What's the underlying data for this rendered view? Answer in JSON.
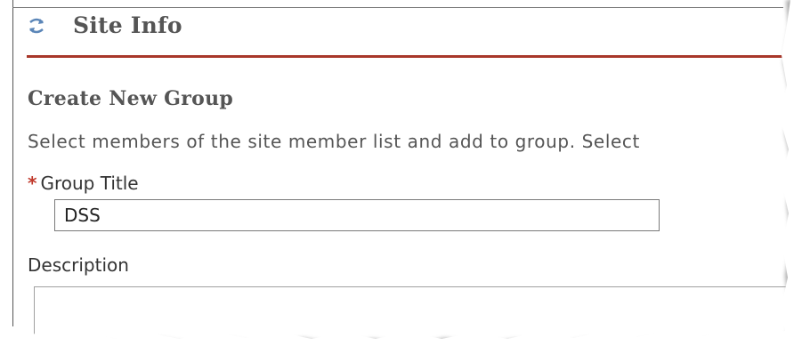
{
  "header": {
    "title": "Site Info",
    "icon": "refresh-arrows-icon"
  },
  "form": {
    "section_title": "Create New Group",
    "instructions": "Select members of the site member list and add to group. Select",
    "required_marker": "*",
    "group_title_label": "Group Title",
    "group_title_value": "DSS",
    "description_label": "Description",
    "description_value": ""
  },
  "colors": {
    "header_rule": "#a8372a",
    "title_text": "#555555",
    "required": "#c0392b"
  }
}
